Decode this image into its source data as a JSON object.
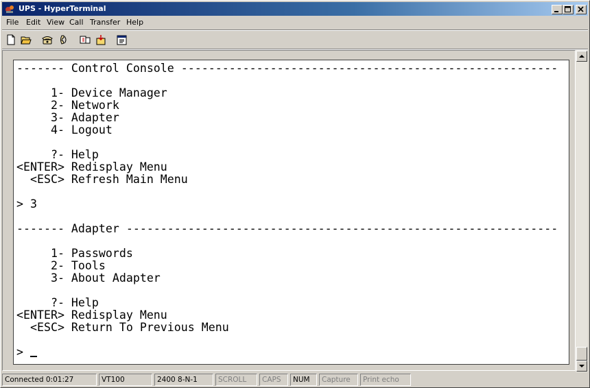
{
  "window": {
    "title": "UPS - HyperTerminal"
  },
  "menu": {
    "items": [
      "File",
      "Edit",
      "View",
      "Call",
      "Transfer",
      "Help"
    ]
  },
  "toolbar": {
    "icons": [
      "new-icon",
      "open-icon",
      "phone-call-icon",
      "disconnect-icon",
      "send-icon",
      "receive-icon",
      "properties-icon"
    ]
  },
  "terminal": {
    "lines": [
      "------- Control Console -------------------------------------------------------",
      "",
      "     1- Device Manager",
      "     2- Network",
      "     3- Adapter",
      "     4- Logout",
      "",
      "     ?- Help",
      "<ENTER> Redisplay Menu",
      "  <ESC> Refresh Main Menu",
      "",
      "> 3",
      "",
      "------- Adapter ---------------------------------------------------------------",
      "",
      "     1- Passwords",
      "     2- Tools",
      "     3- About Adapter",
      "",
      "     ?- Help",
      "<ENTER> Redisplay Menu",
      "  <ESC> Return To Previous Menu",
      "",
      "> "
    ]
  },
  "status": {
    "connected": "Connected 0:01:27",
    "emulation": "VT100",
    "settings": "2400 8-N-1",
    "scroll": "SCROLL",
    "caps": "CAPS",
    "num": "NUM",
    "capture": "Capture",
    "print_echo": "Print echo"
  },
  "colors": {
    "title_start": "#0a246a",
    "title_end": "#a6caf0",
    "chrome": "#d4d0c8",
    "terminal_bg": "#ffffff"
  }
}
